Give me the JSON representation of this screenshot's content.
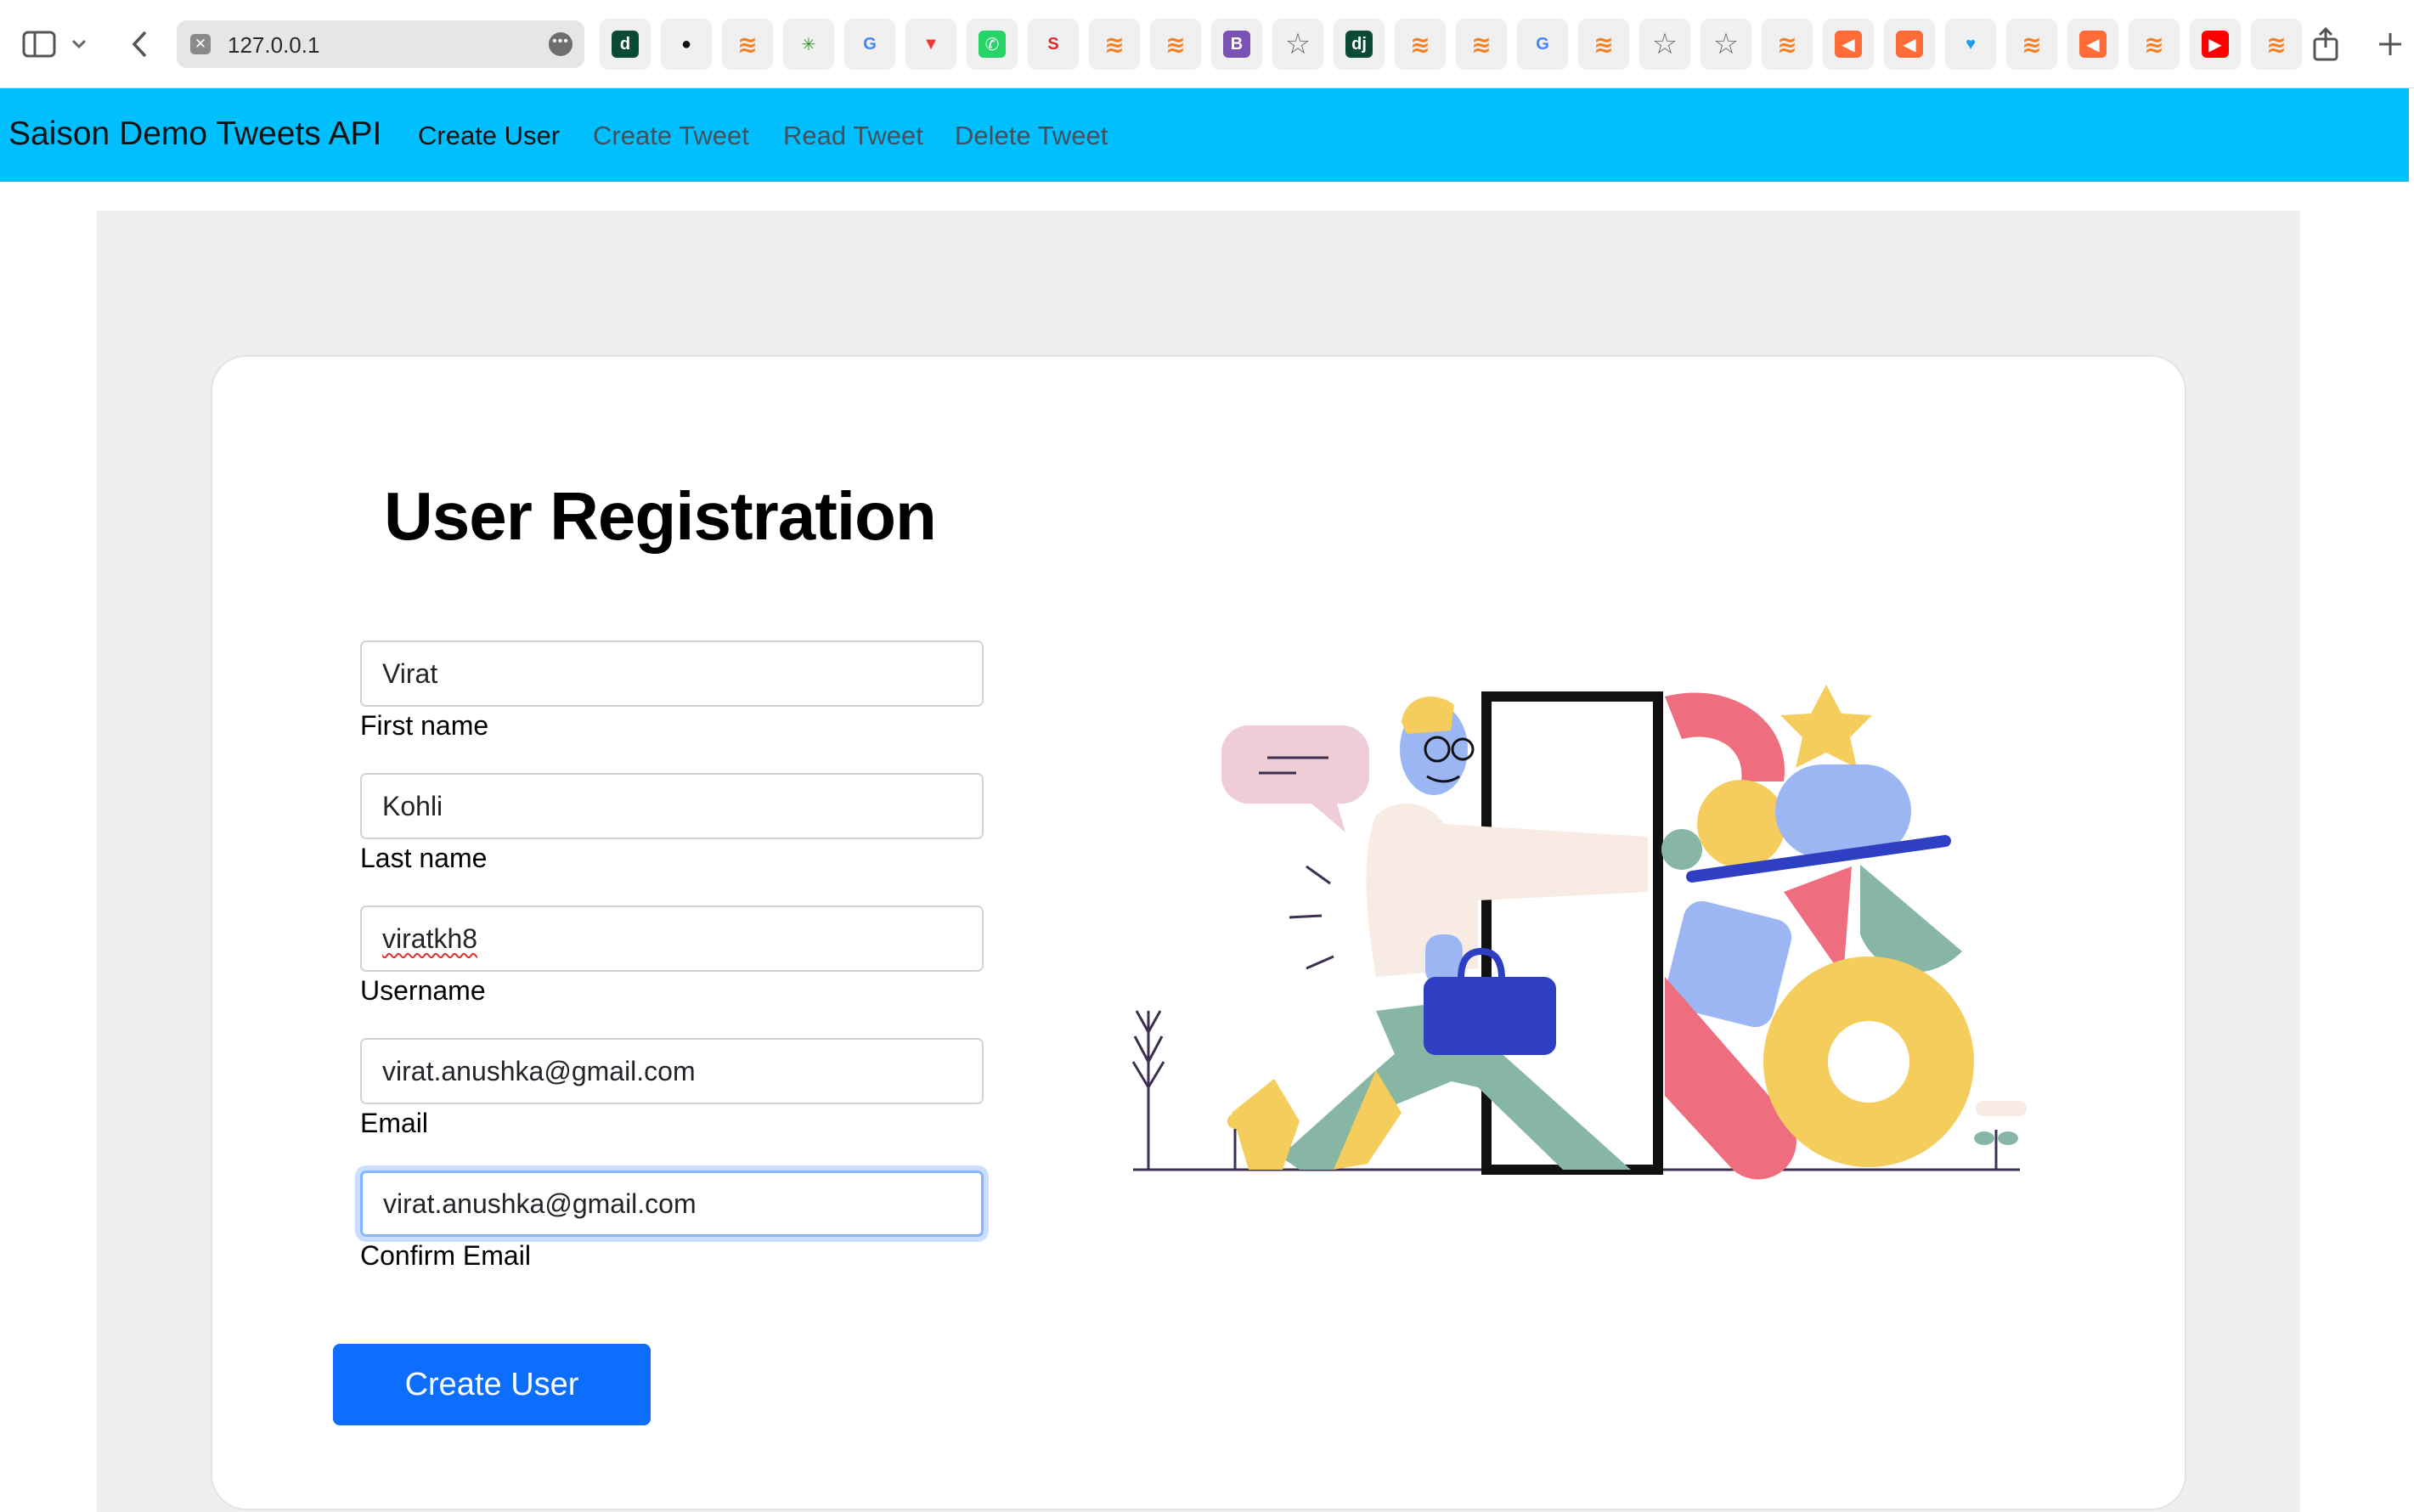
{
  "browser": {
    "url": "127.0.0.1",
    "bookmarks": [
      {
        "icon": "django-icon",
        "glyph": "d"
      },
      {
        "icon": "github-icon",
        "glyph": "●"
      },
      {
        "icon": "stackoverflow-icon",
        "glyph": "≋"
      },
      {
        "icon": "cursor-sparkle-icon",
        "glyph": "✳"
      },
      {
        "icon": "google-icon",
        "glyph": "G"
      },
      {
        "icon": "vivaldi-icon",
        "glyph": "▼"
      },
      {
        "icon": "whatsapp-icon",
        "glyph": "✆"
      },
      {
        "icon": "scribd-icon",
        "glyph": "S"
      },
      {
        "icon": "stackoverflow-icon",
        "glyph": "≋"
      },
      {
        "icon": "stackoverflow-icon",
        "glyph": "≋"
      },
      {
        "icon": "bootstrap-icon",
        "glyph": "B"
      },
      {
        "icon": "star-icon",
        "glyph": "☆"
      },
      {
        "icon": "django-icon",
        "glyph": "dj"
      },
      {
        "icon": "stackoverflow-icon",
        "glyph": "≋"
      },
      {
        "icon": "stackoverflow-icon",
        "glyph": "≋"
      },
      {
        "icon": "google-icon",
        "glyph": "G"
      },
      {
        "icon": "stackoverflow-icon",
        "glyph": "≋"
      },
      {
        "icon": "star-icon",
        "glyph": "☆"
      },
      {
        "icon": "star-icon",
        "glyph": "☆"
      },
      {
        "icon": "stackoverflow-icon",
        "glyph": "≋"
      },
      {
        "icon": "postman-icon",
        "glyph": "◀"
      },
      {
        "icon": "postman-icon",
        "glyph": "◀"
      },
      {
        "icon": "twitter-icon",
        "glyph": "♥"
      },
      {
        "icon": "stackoverflow-icon",
        "glyph": "≋"
      },
      {
        "icon": "postman-icon",
        "glyph": "◀"
      },
      {
        "icon": "stackoverflow-icon",
        "glyph": "≋"
      },
      {
        "icon": "youtube-icon",
        "glyph": "▶"
      },
      {
        "icon": "stackoverflow-icon",
        "glyph": "≋"
      }
    ]
  },
  "navbar": {
    "brand": "Saison Demo Tweets API",
    "links": [
      "Create User",
      "Create Tweet",
      "Read Tweet",
      "Delete Tweet"
    ],
    "active": "Create User",
    "color": "#00bfff"
  },
  "form": {
    "title": "User Registration",
    "fields": [
      {
        "label": "First name",
        "value": "Virat"
      },
      {
        "label": "Last name",
        "value": "Kohli"
      },
      {
        "label": "Username",
        "value": "viratkh8"
      },
      {
        "label": "Email",
        "value": "virat.anushka@gmail.com"
      },
      {
        "label": "Confirm Email",
        "value": "virat.anushka@gmail.com"
      }
    ],
    "submit_label": "Create User",
    "submit_color": "#0d6efd"
  }
}
